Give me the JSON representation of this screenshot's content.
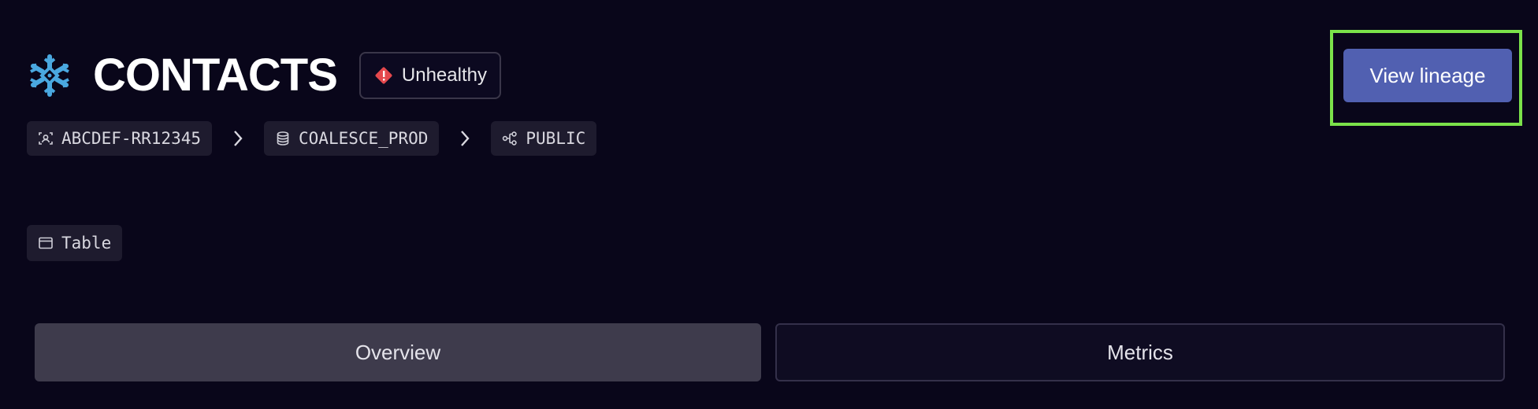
{
  "header": {
    "title": "CONTACTS",
    "logo_icon": "snowflake-icon",
    "status": {
      "icon": "alert-diamond-icon",
      "label": "Unhealthy",
      "color": "#e5484d"
    }
  },
  "breadcrumb": [
    {
      "icon": "account-icon",
      "label": "ABCDEF-RR12345"
    },
    {
      "icon": "database-icon",
      "label": "COALESCE_PROD"
    },
    {
      "icon": "schema-icon",
      "label": "PUBLIC"
    }
  ],
  "object_type": {
    "icon": "table-icon",
    "label": "Table"
  },
  "actions": {
    "view_lineage_label": "View lineage",
    "accent_color": "#5160b1"
  },
  "tabs": [
    {
      "label": "Overview",
      "active": true
    },
    {
      "label": "Metrics",
      "active": false
    }
  ]
}
